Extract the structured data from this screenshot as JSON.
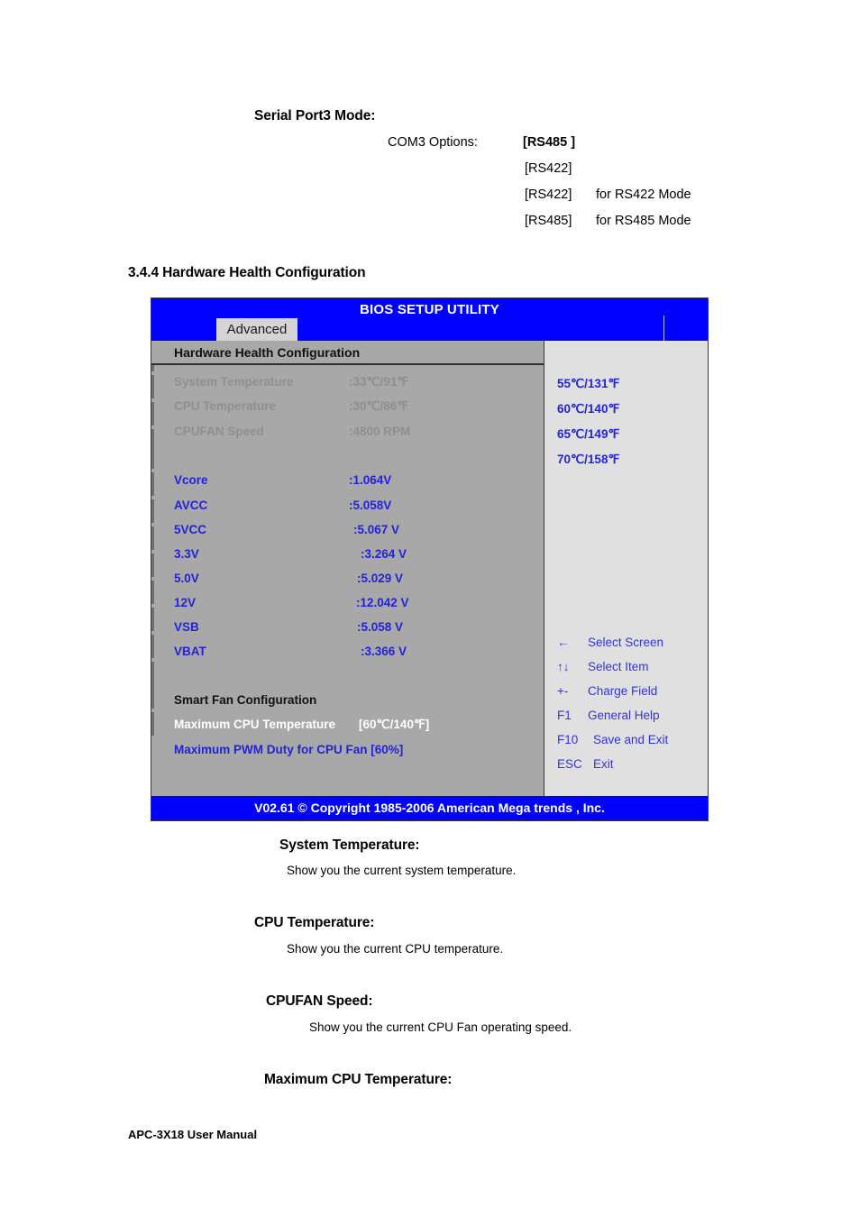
{
  "document": {
    "serial_port": {
      "title": "Serial Port3 Mode:",
      "com3_label": "COM3 Options:",
      "options": [
        {
          "value": "[RS485 ]",
          "desc": ""
        },
        {
          "value": "[RS422]",
          "desc": ""
        },
        {
          "value": "[RS422]",
          "desc": "for RS422 Mode"
        },
        {
          "value": "[RS485]",
          "desc": "for RS485 Mode"
        }
      ]
    },
    "section_heading": "3.4.4 Hardware Health Configuration",
    "descriptions": [
      {
        "term": "System Temperature:",
        "text": "Show you the current system temperature."
      },
      {
        "term": "CPU Temperature:",
        "text": "Show you the current CPU temperature."
      },
      {
        "term": "CPUFAN Speed:",
        "text": "Show you the current CPU Fan operating speed."
      },
      {
        "term": "Maximum CPU Temperature:",
        "text": ""
      }
    ],
    "page_footer": "APC-3X18 User Manual"
  },
  "bios": {
    "title": "BIOS SETUP UTILITY",
    "tab": "Advanced",
    "section_header": "Hardware Health Configuration",
    "readings": [
      {
        "label": "System Temperature",
        "value": ":33℃/91℉"
      },
      {
        "label": "CPU Temperature",
        "value": ":30℃/86℉"
      },
      {
        "label": "CPUFAN Speed",
        "value": ":4800 RPM"
      }
    ],
    "voltages": [
      {
        "label": "Vcore",
        "value": ":1.064V"
      },
      {
        "label": "AVCC",
        "value": ":5.058V"
      },
      {
        "label": "5VCC",
        "value": ":5.067 V"
      },
      {
        "label": "3.3V",
        "value": ":3.264 V"
      },
      {
        "label": "5.0V",
        "value": ":5.029 V"
      },
      {
        "label": "12V",
        "value": ":12.042 V"
      },
      {
        "label": "VSB",
        "value": ":5.058 V"
      },
      {
        "label": "VBAT",
        "value": ":3.366 V"
      }
    ],
    "smart_fan": {
      "header": "Smart Fan Configuration",
      "max_cpu_temp_label": "Maximum CPU Temperature",
      "max_cpu_temp_value": "[60℃/140℉]",
      "max_pwm_duty": "Maximum PWM Duty for CPU Fan [60%]"
    },
    "options": [
      "55℃/131℉",
      "60℃/140℉",
      "65℃/149℉",
      "70℃/158℉"
    ],
    "help_keys": [
      {
        "key": "←",
        "action": "Select Screen"
      },
      {
        "key": "↑↓",
        "action": "Select Item"
      },
      {
        "key": "+-",
        "action": "Charge Field"
      },
      {
        "key": "F1",
        "action": "General Help"
      },
      {
        "key": "F10",
        "action": "Save and Exit"
      },
      {
        "key": "ESC",
        "action": "Exit"
      }
    ],
    "footer": "V02.61 © Copyright 1985-2006 American Mega trends , Inc.",
    "colors": {
      "titlebar": "#0000ff",
      "panel": "#a8a8a8",
      "side_panel": "#e0e0e0",
      "accent_text": "#2222dd",
      "dim_text": "#8f8f8f"
    }
  }
}
